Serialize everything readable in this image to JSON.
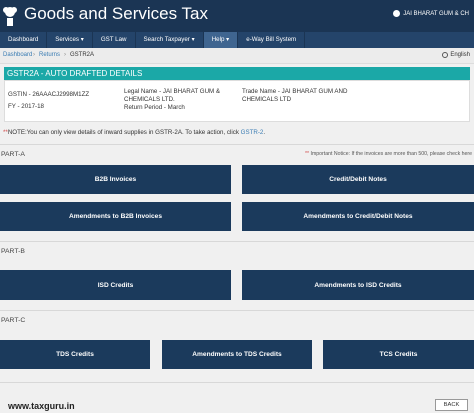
{
  "header": {
    "title": "Goods and Services Tax",
    "user": "JAI BHARAT GUM & CH"
  },
  "nav": [
    "Dashboard",
    "Services ▾",
    "GST Law",
    "Search Taxpayer ▾",
    "Help ▾",
    "e-Way Bill System"
  ],
  "breadcrumb": {
    "dashboard": "Dashboard",
    "sep1": "›",
    "returns": "Returns",
    "sep2": "›",
    "current": "GSTR2A"
  },
  "language": "English",
  "section_title": "GSTR2A - AUTO DRAFTED DETAILS",
  "details": {
    "gstin": "GSTIN - 26AAACJ2998M1ZZ",
    "fy": "FY - 2017-18",
    "legal_name": "Legal Name - JAI BHARAT GUM & CHEMICALS LTD.",
    "return_period": "Return Period - March",
    "trade_name": "Trade Name - JAI BHARAT GUM AND CHEMICALS LTD"
  },
  "note": {
    "asterisk": "**",
    "text": "NOTE:You can only view details of inward supplies in GSTR-2A. To take action, click ",
    "link": "GSTR-2",
    "end": "."
  },
  "important_notice": {
    "asterisk": "**",
    "text": " Important Notice: If the invoices are more than 500, please check here"
  },
  "part_a": {
    "label": "PART-A",
    "tiles": [
      "B2B Invoices",
      "Credit/Debit Notes",
      "Amendments to B2B Invoices",
      "Amendments to Credit/Debit Notes"
    ]
  },
  "part_b": {
    "label": "PART-B",
    "tiles": [
      "ISD Credits",
      "Amendments to ISD Credits"
    ]
  },
  "part_c": {
    "label": "PART-C",
    "tiles": [
      "TDS Credits",
      "Amendments to TDS Credits",
      "TCS Credits"
    ]
  },
  "footer": {
    "watermark": "www.taxguru.in",
    "back": "BACK"
  },
  "colors": {
    "header": "#1b3554",
    "nav": "#24446a",
    "teal": "#1ba8a7",
    "tile": "#1b3a5c"
  },
  "icons": [
    "national-emblem-icon",
    "user-icon",
    "globe-icon"
  ]
}
